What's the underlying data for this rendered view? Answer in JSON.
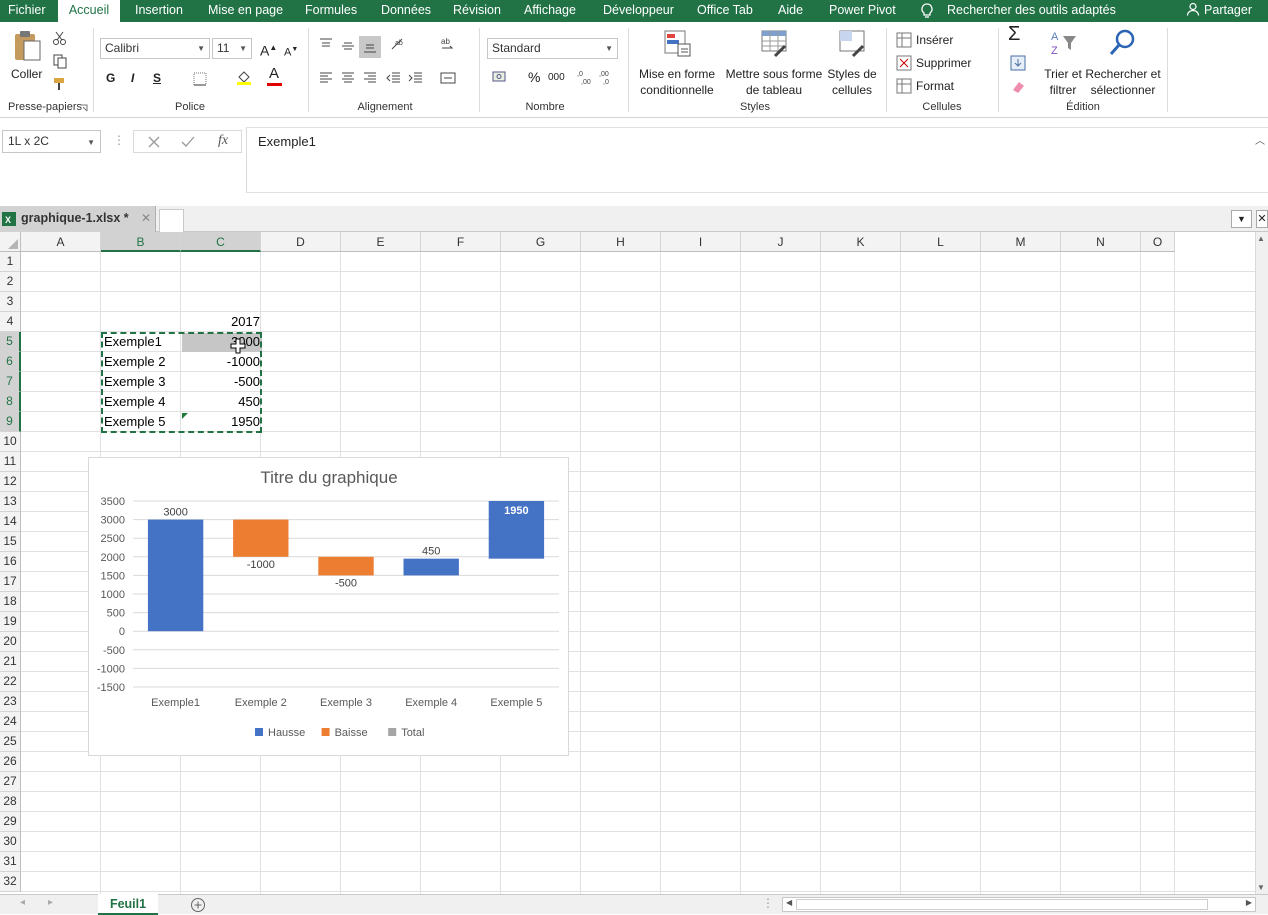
{
  "menu": {
    "tabs": [
      "Fichier",
      "Accueil",
      "Insertion",
      "Mise en page",
      "Formules",
      "Données",
      "Révision",
      "Affichage",
      "Développeur",
      "Office Tab",
      "Aide",
      "Power Pivot"
    ],
    "search": "Rechercher des outils adaptés",
    "share": "Partager"
  },
  "ribbon": {
    "clipboard": {
      "paste": "Coller",
      "label": "Presse-papiers"
    },
    "font": {
      "name": "Calibri",
      "size": "11",
      "bold": "G",
      "italic": "I",
      "underline": "S",
      "label": "Police"
    },
    "alignment": {
      "label": "Alignement"
    },
    "number": {
      "format": "Standard",
      "percent": "%",
      "thousands": "000",
      "label": "Nombre"
    },
    "styles": {
      "cond_fmt": [
        "Mise en forme",
        "conditionnelle"
      ],
      "table_fmt": [
        "Mettre sous forme",
        "de tableau"
      ],
      "cell_styles": [
        "Styles de",
        "cellules"
      ],
      "label": "Styles"
    },
    "cells": {
      "insert": "Insérer",
      "delete": "Supprimer",
      "format": "Format",
      "label": "Cellules"
    },
    "editing": {
      "sort": [
        "Trier et",
        "filtrer"
      ],
      "find": [
        "Rechercher et",
        "sélectionner"
      ],
      "label": "Édition"
    }
  },
  "formula_bar": {
    "name_box": "1L x 2C",
    "content": "Exemple1"
  },
  "document": {
    "file_tab": "graphique-1.xlsx *"
  },
  "columns": [
    "A",
    "B",
    "C",
    "D",
    "E",
    "F",
    "G",
    "H",
    "I",
    "J",
    "K",
    "L",
    "M",
    "N",
    "O"
  ],
  "rows": [
    "1",
    "2",
    "3",
    "4",
    "5",
    "6",
    "7",
    "8",
    "9",
    "10",
    "11",
    "12",
    "13",
    "14",
    "15",
    "16",
    "17",
    "18",
    "19",
    "20",
    "21",
    "22",
    "23",
    "24",
    "25",
    "26",
    "27",
    "28",
    "29",
    "30",
    "31",
    "32"
  ],
  "cells": {
    "c4": "2017",
    "b5": "Exemple1",
    "c5": "3000",
    "b6": "Exemple 2",
    "c6": "-1000",
    "b7": "Exemple 3",
    "c7": "-500",
    "b8": "Exemple 4",
    "c8": "450",
    "b9": "Exemple 5",
    "c9": "1950"
  },
  "sheet": {
    "name": "Feuil1"
  },
  "chart_data": {
    "type": "bar",
    "title": "Titre du graphique",
    "categories": [
      "Exemple1",
      "Exemple 2",
      "Exemple 3",
      "Exemple 4",
      "Exemple 5"
    ],
    "values": [
      3000,
      -1000,
      -500,
      450,
      1950
    ],
    "bars": [
      {
        "base": 0,
        "top": 3000,
        "series": "Hausse",
        "label": "3000"
      },
      {
        "base": 2000,
        "top": 3000,
        "series": "Baisse",
        "label": "-1000"
      },
      {
        "base": 1500,
        "top": 2000,
        "series": "Baisse",
        "label": "-500"
      },
      {
        "base": 1500,
        "top": 1950,
        "series": "Hausse",
        "label": "450"
      },
      {
        "base": 1950,
        "top": 3500,
        "series": "Hausse",
        "label": "1950"
      }
    ],
    "yticks": [
      "3500",
      "3000",
      "2500",
      "2000",
      "1500",
      "1000",
      "500",
      "0",
      "-500",
      "-1000",
      "-1500"
    ],
    "ylim": [
      -1500,
      3500
    ],
    "legend": [
      {
        "name": "Hausse",
        "color": "#4472c4"
      },
      {
        "name": "Baisse",
        "color": "#ed7d31"
      },
      {
        "name": "Total",
        "color": "#a5a5a5"
      }
    ],
    "legend_position": "bottom",
    "grid": true
  },
  "colors": {
    "excel_green": "#217346",
    "hausse": "#4472c4",
    "baisse": "#ed7d31",
    "total": "#a5a5a5"
  }
}
